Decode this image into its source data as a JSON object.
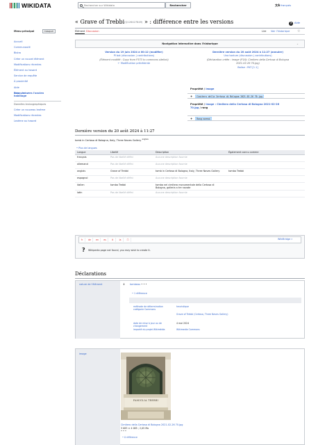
{
  "header": {
    "logo_text": "WIKIDATA",
    "logo_colors": [
      "#990000",
      "#339966",
      "#006699"
    ],
    "search_placeholder": "Rechercher sur Wikidata",
    "search_button": "Rechercher",
    "lang_icon": "文A",
    "language": "français"
  },
  "sidebar": {
    "menu_heading": "Menu principal",
    "hide_button": "masquer",
    "items_a": [
      "Accueil",
      "Communauté",
      "Bistro",
      "Créer un nouvel élément",
      "Modifications récentes",
      "Élément au hasard",
      "Service de requête",
      "À proximité",
      "Aide",
      "Faire un don"
    ],
    "lexeme_link": "Basculer vers l'ancien habillage",
    "lexeme_heading": "Données lexicographiques",
    "items_b": [
      "Créer un nouveau lexème",
      "Modifications récentes",
      "Lexème au hasard"
    ]
  },
  "page": {
    "title_main": "« Grave of Trebbi",
    "qid": "(Q126427849)",
    "title_rest": " » : différence entre les versions",
    "help": "Aide",
    "help_icon": "?",
    "tab_item": "Élément",
    "tab_discussion": "Discussion",
    "tab_read": "Lire",
    "tab_history": "Voir l'historique",
    "star": "☆",
    "nav_history": "Navigation interactive dans l'historique",
    "nav_chevron": "⌄"
  },
  "diff": {
    "left": {
      "version": "Version du 19 juin 2024 à 00:12 (modifier)",
      "user": "PI bot (discussion | contributions)",
      "summary": "(Élément modifié : Copy from P373 to commons sitelink)",
      "prev": "← Modification précédente"
    },
    "right": {
      "version": "Dernière version du 20 août 2024 à 11:27 (annuler)",
      "user": "Una tantum (discussion | contributions)",
      "summary1": "(Déclaration créée : image (P18): Cimitero della Certosa di Bologna",
      "summary2": "2021-02-26 70.jpg)",
      "tag": "Balise : PAT [1.1]"
    },
    "prop1_name": "Propriété",
    "prop1_value": "image",
    "added_file": "Cimitero della Certosa di Bologna 2021-02-26 70.jpg",
    "prop2_name": "Propriété",
    "prop2_line1": "image : Cimitero della Certosa di Bologna 2021-02-26",
    "prop2_line2": "70.jpg",
    "prop2_rank": "rang",
    "added_rank": "Rang normal",
    "plus": "+"
  },
  "lastversion": {
    "heading": "Dernière version du 20 août 2024 à 11:27",
    "desc": "tomb in Certosa di Bologna, Italy, Three Naves Gallery",
    "desc_lang": "anglais",
    "more_languages": "• Plus de langues"
  },
  "langtable": {
    "headers": [
      "Langue",
      "Libellé",
      "Description",
      "Également connu comme"
    ],
    "rows": [
      {
        "lang": "français",
        "label": "Pas de libellé défini",
        "label_missing": true,
        "desc": "Aucune description fournie",
        "desc_missing": true,
        "aka": ""
      },
      {
        "lang": "allemand",
        "label": "Pas de libellé défini",
        "label_missing": true,
        "desc": "Aucune description fournie",
        "desc_missing": true,
        "aka": ""
      },
      {
        "lang": "anglais",
        "label": "Grave of Trebbi",
        "label_missing": false,
        "desc": "tomb in Certosa di Bologna, Italy, Three Naves Gallery",
        "desc_missing": false,
        "aka": "tomba Trebbi"
      },
      {
        "lang": "espagnol",
        "label": "Pas de libellé défini",
        "label_missing": true,
        "desc": "Aucune description fournie",
        "desc_missing": true,
        "aka": ""
      },
      {
        "lang": "italien",
        "label": "tomba Trebbi",
        "label_missing": false,
        "desc": "tomba nel cimitero monumentale della Certosa di Bologna, galleria a tre navate",
        "desc_missing": false,
        "aka": ""
      },
      {
        "lang": "latin",
        "label": "Pas de libellé défini",
        "label_missing": true,
        "desc": "Aucune description fournie",
        "desc_missing": true,
        "aka": ""
      }
    ]
  },
  "sitelinks": {
    "tabs": [
      "fr",
      "de",
      "en",
      "es",
      "it",
      "la",
      "☐"
    ],
    "wikibridge": "WikiBridge »",
    "qmark": "?",
    "notfound": "Wikipedia page not found, you may wish to create it."
  },
  "declarations": {
    "heading": "Déclarations",
    "stmt1": {
      "property": "nature de l'élément",
      "rank": "⇕",
      "value": "tombeau",
      "value_dots": "• • •",
      "ref_count": "• 1 référence",
      "qualifiers": [
        {
          "key": "méthode de détermination catégorie Commons",
          "value": "heuristique"
        },
        {
          "key": "",
          "value": "Grave of Trebbi (Certosa, Three Naves Gallery)"
        },
        {
          "key": "date de mise à jour ou de changement",
          "value": "4 mai 2024"
        },
        {
          "key": "importé du projet Wikimédia",
          "value": "Wikimedia Commons"
        }
      ]
    },
    "stmt2": {
      "property": "image",
      "rank": "⇕",
      "photo_caption_top": "FAMIGLIA TREBBI",
      "file": "Cimitero della Certosa di Bologna 2021-02-26 70.jpg",
      "dims": "3 083 × 4 085 ; 2,05 Mo",
      "dots": "• • •",
      "ref_count": "• 0 référence"
    }
  }
}
